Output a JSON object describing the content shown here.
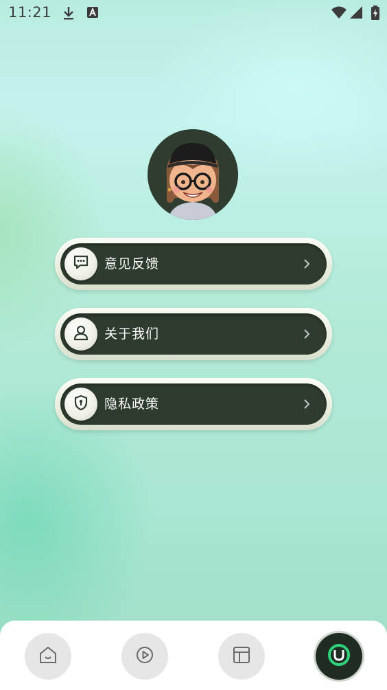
{
  "status_bar": {
    "time": "11:21",
    "icons": [
      "download-icon",
      "a-notification-icon",
      "wifi-icon",
      "signal-icon",
      "battery-icon"
    ]
  },
  "profile": {
    "avatar": "avatar-icon"
  },
  "menu": {
    "items": [
      {
        "label": "意见反馈",
        "icon": "chat-bubble-icon"
      },
      {
        "label": "关于我们",
        "icon": "person-icon"
      },
      {
        "label": "隐私政策",
        "icon": "shield-icon"
      }
    ]
  },
  "bottom_nav": {
    "items": [
      {
        "icon": "home-icon",
        "active": false
      },
      {
        "icon": "play-icon",
        "active": false
      },
      {
        "icon": "layout-icon",
        "active": false
      },
      {
        "icon": "profile-icon",
        "active": true
      }
    ]
  },
  "colors": {
    "menu_dark": "#2e3b2f",
    "active_nav": "#1f2c22",
    "accent_green": "#2fd27a"
  }
}
